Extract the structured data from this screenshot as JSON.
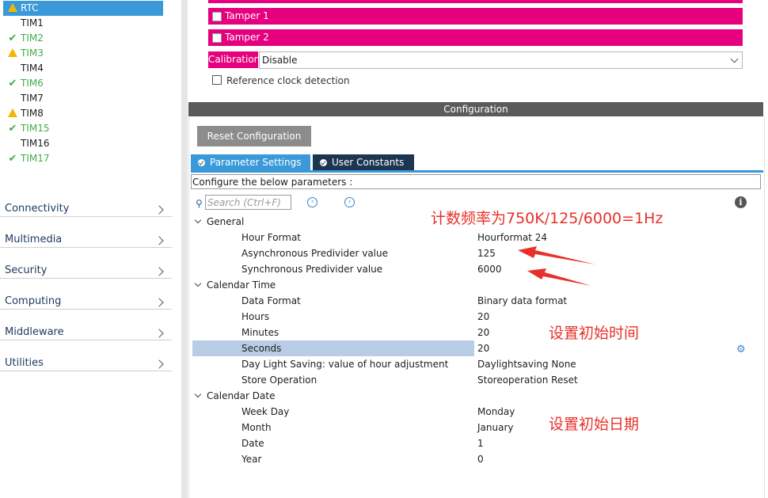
{
  "left_panel": {
    "peripherals": [
      {
        "label": "RTC",
        "status": "warning",
        "selected": true
      },
      {
        "label": "TIM1",
        "status": "none"
      },
      {
        "label": "TIM2",
        "status": "ok"
      },
      {
        "label": "TIM3",
        "status": "warning"
      },
      {
        "label": "TIM4",
        "status": "none"
      },
      {
        "label": "TIM6",
        "status": "ok"
      },
      {
        "label": "TIM7",
        "status": "none"
      },
      {
        "label": "TIM8",
        "status": "warning"
      },
      {
        "label": "TIM15",
        "status": "ok"
      },
      {
        "label": "TIM16",
        "status": "none"
      },
      {
        "label": "TIM17",
        "status": "ok"
      }
    ],
    "categories": [
      "Connectivity",
      "Multimedia",
      "Security",
      "Computing",
      "Middleware",
      "Utilities"
    ]
  },
  "mode": {
    "tamper1_label": "Tamper 1",
    "tamper2_label": "Tamper 2",
    "calibration_label": "Calibration",
    "calibration_value": "Disable",
    "refclk_label": "Reference clock detection"
  },
  "config": {
    "title": "Configuration",
    "reset_label": "Reset Configuration",
    "tabs": [
      "Parameter Settings",
      "User Constants"
    ],
    "configure_label": "Configure the below parameters :",
    "search_placeholder": "Search (Ctrl+F)",
    "groups": [
      {
        "name": "General",
        "params": [
          {
            "key": "Hour Format",
            "value": "Hourformat 24"
          },
          {
            "key": "Asynchronous Predivider value",
            "value": "125"
          },
          {
            "key": "Synchronous Predivider value",
            "value": "6000"
          }
        ]
      },
      {
        "name": "Calendar Time",
        "params": [
          {
            "key": "Data Format",
            "value": "Binary data format"
          },
          {
            "key": "Hours",
            "value": "20"
          },
          {
            "key": "Minutes",
            "value": "20"
          },
          {
            "key": "Seconds",
            "value": "20"
          },
          {
            "key": "Day Light Saving: value of hour adjustment",
            "value": "Daylightsaving None"
          },
          {
            "key": "Store Operation",
            "value": "Storeoperation Reset"
          }
        ]
      },
      {
        "name": "Calendar Date",
        "params": [
          {
            "key": "Week Day",
            "value": "Monday"
          },
          {
            "key": "Month",
            "value": "January"
          },
          {
            "key": "Date",
            "value": "1"
          },
          {
            "key": "Year",
            "value": "0"
          }
        ]
      }
    ]
  },
  "annotations": {
    "freq_note": "计数频率为750K/125/6000=1Hz",
    "time_note": "设置初始时间",
    "date_note": "设置初始日期"
  },
  "colors": {
    "accent": "#3a9ad9",
    "mode_pink": "#e6007e",
    "annotation_red": "#e8302a",
    "ok_green": "#3fae49"
  }
}
